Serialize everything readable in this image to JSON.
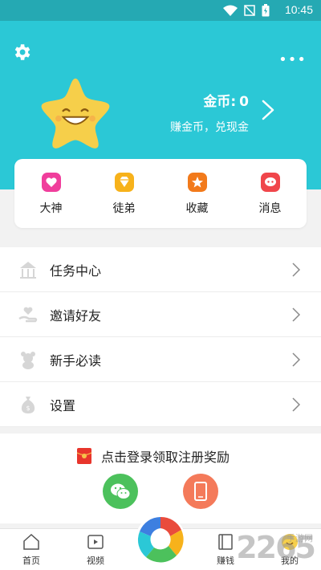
{
  "status_bar": {
    "time": "10:45"
  },
  "header": {
    "coins_label": "金币:",
    "coins_value": "0",
    "earn_text": "赚金币，兑现金",
    "more_dots": "•••"
  },
  "quick_actions": [
    {
      "label": "大神",
      "icon": "heart-icon",
      "color": "#f03e9c"
    },
    {
      "label": "徒弟",
      "icon": "diamond-icon",
      "color": "#f7b21b"
    },
    {
      "label": "收藏",
      "icon": "star-badge-icon",
      "color": "#f27a1b"
    },
    {
      "label": "消息",
      "icon": "chat-icon",
      "color": "#f0464b"
    }
  ],
  "menu": [
    {
      "label": "任务中心",
      "icon": "carousel-icon"
    },
    {
      "label": "邀请好友",
      "icon": "hand-heart-icon"
    },
    {
      "label": "新手必读",
      "icon": "bear-icon"
    },
    {
      "label": "设置",
      "icon": "money-bag-icon"
    }
  ],
  "login": {
    "text": "点击登录领取注册奖励",
    "wechat_icon": "wechat-icon",
    "phone_icon": "phone-icon"
  },
  "tabbar": [
    {
      "label": "首页",
      "icon": "home-icon"
    },
    {
      "label": "视频",
      "icon": "video-icon"
    },
    {
      "label": "赚钱",
      "icon": "book-icon"
    },
    {
      "label": "我的",
      "icon": "profile-icon"
    }
  ],
  "watermark": {
    "number": "2265",
    "text": "手游网"
  },
  "colors": {
    "header_bg": "#2bc8d6",
    "status_bg": "#25a9b3",
    "wechat": "#4cc15c",
    "phone": "#f47a5a"
  }
}
